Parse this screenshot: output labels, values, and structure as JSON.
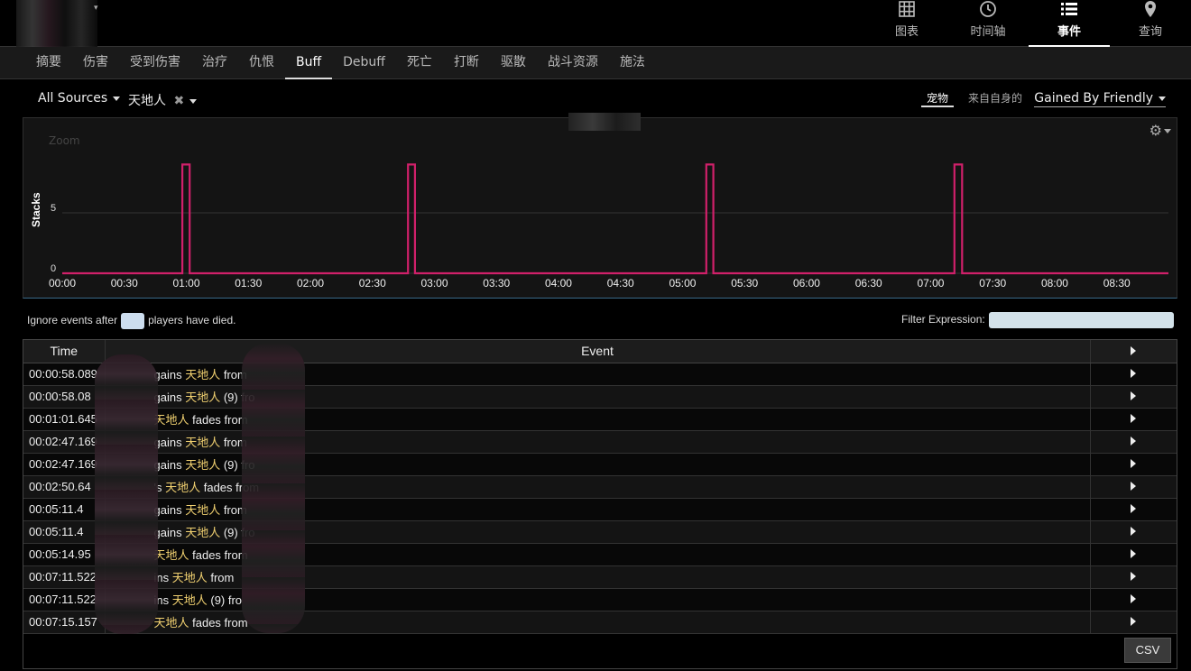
{
  "top_nav": [
    {
      "label": "图表",
      "icon": "grid-icon"
    },
    {
      "label": "时间轴",
      "icon": "clock-icon"
    },
    {
      "label": "事件",
      "icon": "list-icon",
      "active": true
    },
    {
      "label": "查询",
      "icon": "map-pin-icon"
    }
  ],
  "tabs": [
    "摘要",
    "伤害",
    "受到伤害",
    "治疗",
    "仇恨",
    "Buff",
    "Debuff",
    "死亡",
    "打断",
    "驱散",
    "战斗资源",
    "施法"
  ],
  "active_tab": "Buff",
  "filters": {
    "source": "All Sources",
    "ability": "天地人",
    "remove_symbol": "✖",
    "pet_label": "宠物",
    "self_label": "来自自身的",
    "gained_by": "Gained By Friendly"
  },
  "chart": {
    "zoom_label": "Zoom"
  },
  "chart_data": {
    "type": "line",
    "ylabel": "Stacks",
    "xlabel": "",
    "yticks": [
      0,
      5
    ],
    "xticks": [
      "00:00",
      "00:30",
      "01:00",
      "01:30",
      "02:00",
      "02:30",
      "03:00",
      "03:30",
      "04:00",
      "04:30",
      "05:00",
      "05:30",
      "06:00",
      "06:30",
      "07:00",
      "07:30",
      "08:00",
      "08:30"
    ],
    "x_range_seconds": [
      0,
      535
    ],
    "ylim": [
      0,
      10
    ],
    "color": "#d0206a",
    "series": [
      {
        "values": [
          [
            0,
            0
          ],
          [
            58.1,
            0
          ],
          [
            58.1,
            9
          ],
          [
            61.6,
            9
          ],
          [
            61.6,
            0
          ],
          [
            167.2,
            0
          ],
          [
            167.2,
            9
          ],
          [
            170.6,
            9
          ],
          [
            170.6,
            0
          ],
          [
            311.5,
            0
          ],
          [
            311.5,
            9
          ],
          [
            314.9,
            9
          ],
          [
            314.9,
            0
          ],
          [
            431.5,
            0
          ],
          [
            431.5,
            9
          ],
          [
            435.2,
            9
          ],
          [
            435.2,
            0
          ],
          [
            535,
            0
          ]
        ]
      }
    ]
  },
  "ignore": {
    "prefix": "Ignore events after",
    "suffix": "players have died."
  },
  "filter_expression_label": "Filter Expression:",
  "table": {
    "headers": {
      "time": "Time",
      "event": "Event"
    },
    "rows": [
      {
        "time": "00:00:58.089",
        "pre": "gains ",
        "buff": "天地人",
        "post": " from"
      },
      {
        "time": "00:00:58.08",
        "pre": "gains ",
        "buff": "天地人",
        "post": " (9) fro"
      },
      {
        "time": "00:01:01.645",
        "pre": "",
        "buff": "天地人",
        "post": " fades from"
      },
      {
        "time": "00:02:47.169",
        "pre": "gains ",
        "buff": "天地人",
        "post": " from"
      },
      {
        "time": "00:02:47.169",
        "pre": "gains ",
        "buff": "天地人",
        "post": " (9) fro"
      },
      {
        "time": "00:02:50.64",
        "pre": "'s ",
        "buff": "天地人",
        "post": " fades from"
      },
      {
        "time": "00:05:11.4",
        "pre": "gains ",
        "buff": "天地人",
        "post": " from"
      },
      {
        "time": "00:05:11.4",
        "pre": "gains ",
        "buff": "天地人",
        "post": " (9) fro"
      },
      {
        "time": "00:05:14.95",
        "pre": "",
        "buff": "天地人",
        "post": " fades from"
      },
      {
        "time": "00:07:11.522",
        "pre": "ins ",
        "buff": "天地人",
        "post": " from"
      },
      {
        "time": "00:07:11.522",
        "pre": "ins ",
        "buff": "天地人",
        "post": " (9) fro"
      },
      {
        "time": "00:07:15.157",
        "pre": "",
        "buff": "天地人",
        "post": " fades from"
      }
    ]
  },
  "csv_label": "CSV"
}
